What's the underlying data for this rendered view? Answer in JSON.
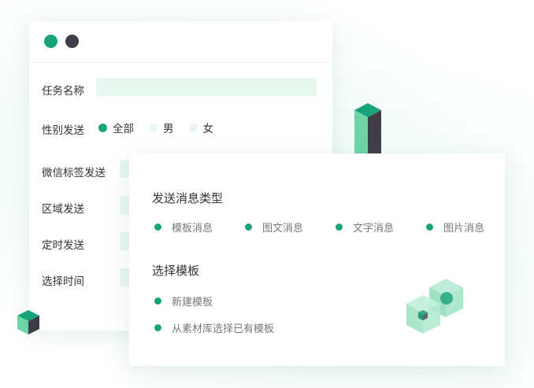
{
  "window": {
    "controls": [
      "close-dot",
      "minimize-dot"
    ]
  },
  "task_form": {
    "task_name_label": "任务名称",
    "task_name_value": "",
    "gender_label": "性别发送",
    "gender_options": [
      {
        "label": "全部",
        "selected": true
      },
      {
        "label": "男",
        "selected": false
      },
      {
        "label": "女",
        "selected": false
      }
    ],
    "wechat_tag_label": "微信标签发送",
    "region_label": "区域发送",
    "scheduled_label": "定时发送",
    "select_time_label": "选择时间"
  },
  "message_card": {
    "type_title": "发送消息类型",
    "type_options": [
      {
        "label": "模板消息"
      },
      {
        "label": "图文消息"
      },
      {
        "label": "文字消息"
      },
      {
        "label": "图片消息"
      }
    ],
    "template_title": "选择模板",
    "template_options": [
      {
        "label": "新建模板"
      },
      {
        "label": "从素材库选择已有模板"
      }
    ]
  },
  "colors": {
    "accent": "#19a37a",
    "dark": "#3f3d48",
    "input_bg": "#e9f7f1",
    "cube_light": "#9fe3c4",
    "cube_mid": "#6fd3a6"
  }
}
